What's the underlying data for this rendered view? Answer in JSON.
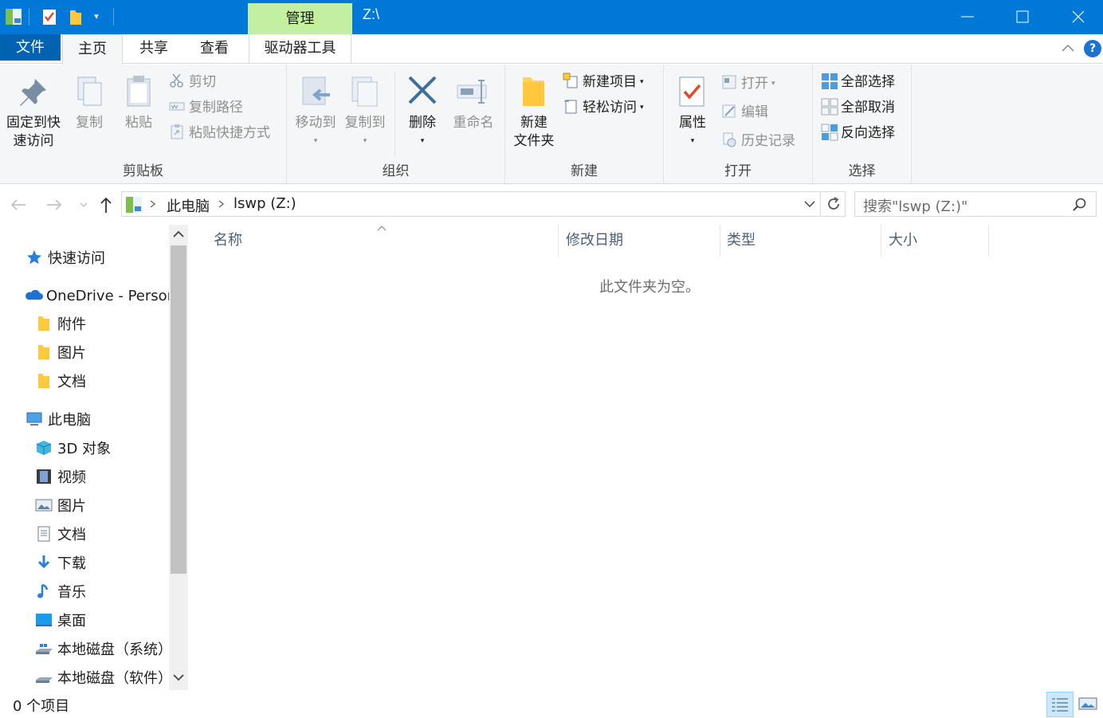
{
  "titlebar": {
    "manage_tab": "管理",
    "title": "Z:\\"
  },
  "tabs": {
    "file": "文件",
    "home": "主页",
    "share": "共享",
    "view": "查看",
    "drive_tools": "驱动器工具"
  },
  "ribbon": {
    "clipboard": {
      "label": "剪贴板",
      "pin_line1": "固定到快",
      "pin_line2": "速访问",
      "copy": "复制",
      "paste": "粘贴",
      "cut": "剪切",
      "copy_path": "复制路径",
      "paste_shortcut": "粘贴快捷方式"
    },
    "organize": {
      "label": "组织",
      "move_to": "移动到",
      "copy_to": "复制到",
      "delete": "删除",
      "rename": "重命名"
    },
    "new": {
      "label": "新建",
      "new_folder_line1": "新建",
      "new_folder_line2": "文件夹",
      "new_item": "新建项目",
      "easy_access": "轻松访问"
    },
    "open": {
      "label": "打开",
      "properties": "属性",
      "open": "打开",
      "edit": "编辑",
      "history": "历史记录"
    },
    "select": {
      "label": "选择",
      "select_all": "全部选择",
      "select_none": "全部取消",
      "invert": "反向选择"
    }
  },
  "address": {
    "crumbs": [
      "此电脑",
      "lswp (Z:)"
    ],
    "search_placeholder": "搜索\"lswp (Z:)\""
  },
  "navpane": {
    "items": [
      {
        "label": "快速访问",
        "icon": "star-icon"
      },
      {
        "label": "OneDrive - Person",
        "icon": "cloud-icon"
      },
      {
        "label": "附件",
        "icon": "folder-icon"
      },
      {
        "label": "图片",
        "icon": "folder-icon"
      },
      {
        "label": "文档",
        "icon": "folder-icon"
      },
      {
        "label": "此电脑",
        "icon": "computer-icon"
      },
      {
        "label": "3D 对象",
        "icon": "cube-icon"
      },
      {
        "label": "视频",
        "icon": "film-icon"
      },
      {
        "label": "图片",
        "icon": "picture-icon"
      },
      {
        "label": "文档",
        "icon": "document-icon"
      },
      {
        "label": "下载",
        "icon": "download-icon"
      },
      {
        "label": "音乐",
        "icon": "music-icon"
      },
      {
        "label": "桌面",
        "icon": "desktop-icon"
      },
      {
        "label": "本地磁盘（系统）",
        "icon": "drive-icon"
      },
      {
        "label": "本地磁盘（软件）",
        "icon": "drive-icon"
      }
    ]
  },
  "content": {
    "columns": [
      "名称",
      "修改日期",
      "类型",
      "大小"
    ],
    "empty_message": "此文件夹为空。"
  },
  "status": {
    "item_count": "0 个项目"
  },
  "colors": {
    "titlebar": "#0078d7",
    "manage_tab": "#c3efa0",
    "file_tab": "#0063b1"
  }
}
